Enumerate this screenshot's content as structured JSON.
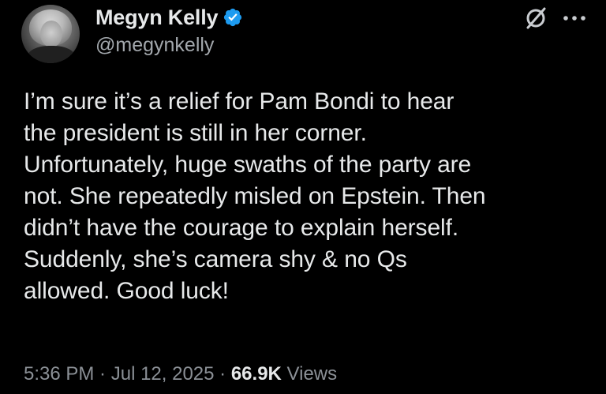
{
  "author": {
    "display_name": "Megyn Kelly",
    "handle": "@megynkelly",
    "verified": true
  },
  "tweet": {
    "lines": [
      "I’m sure it’s a relief for Pam Bondi to hear",
      "the president is still in her corner.",
      "Unfortunately, huge swaths of the party are",
      "not. She repeatedly misled on Epstein. Then",
      "didn’t have the courage to explain herself.",
      "Suddenly, she’s camera shy & no Qs",
      "allowed. Good luck!"
    ]
  },
  "meta": {
    "time": "5:36 PM",
    "separator": " · ",
    "date": "Jul 12, 2025",
    "views_count": "66.9K",
    "views_label": " Views"
  },
  "icons": {
    "verified_badge": "verified-badge-icon",
    "grok": "grok-icon",
    "more": "more-icon"
  },
  "colors": {
    "background": "#000000",
    "text": "#e7e9ea",
    "secondary": "#8b9096",
    "verified": "#1d9bf0"
  }
}
